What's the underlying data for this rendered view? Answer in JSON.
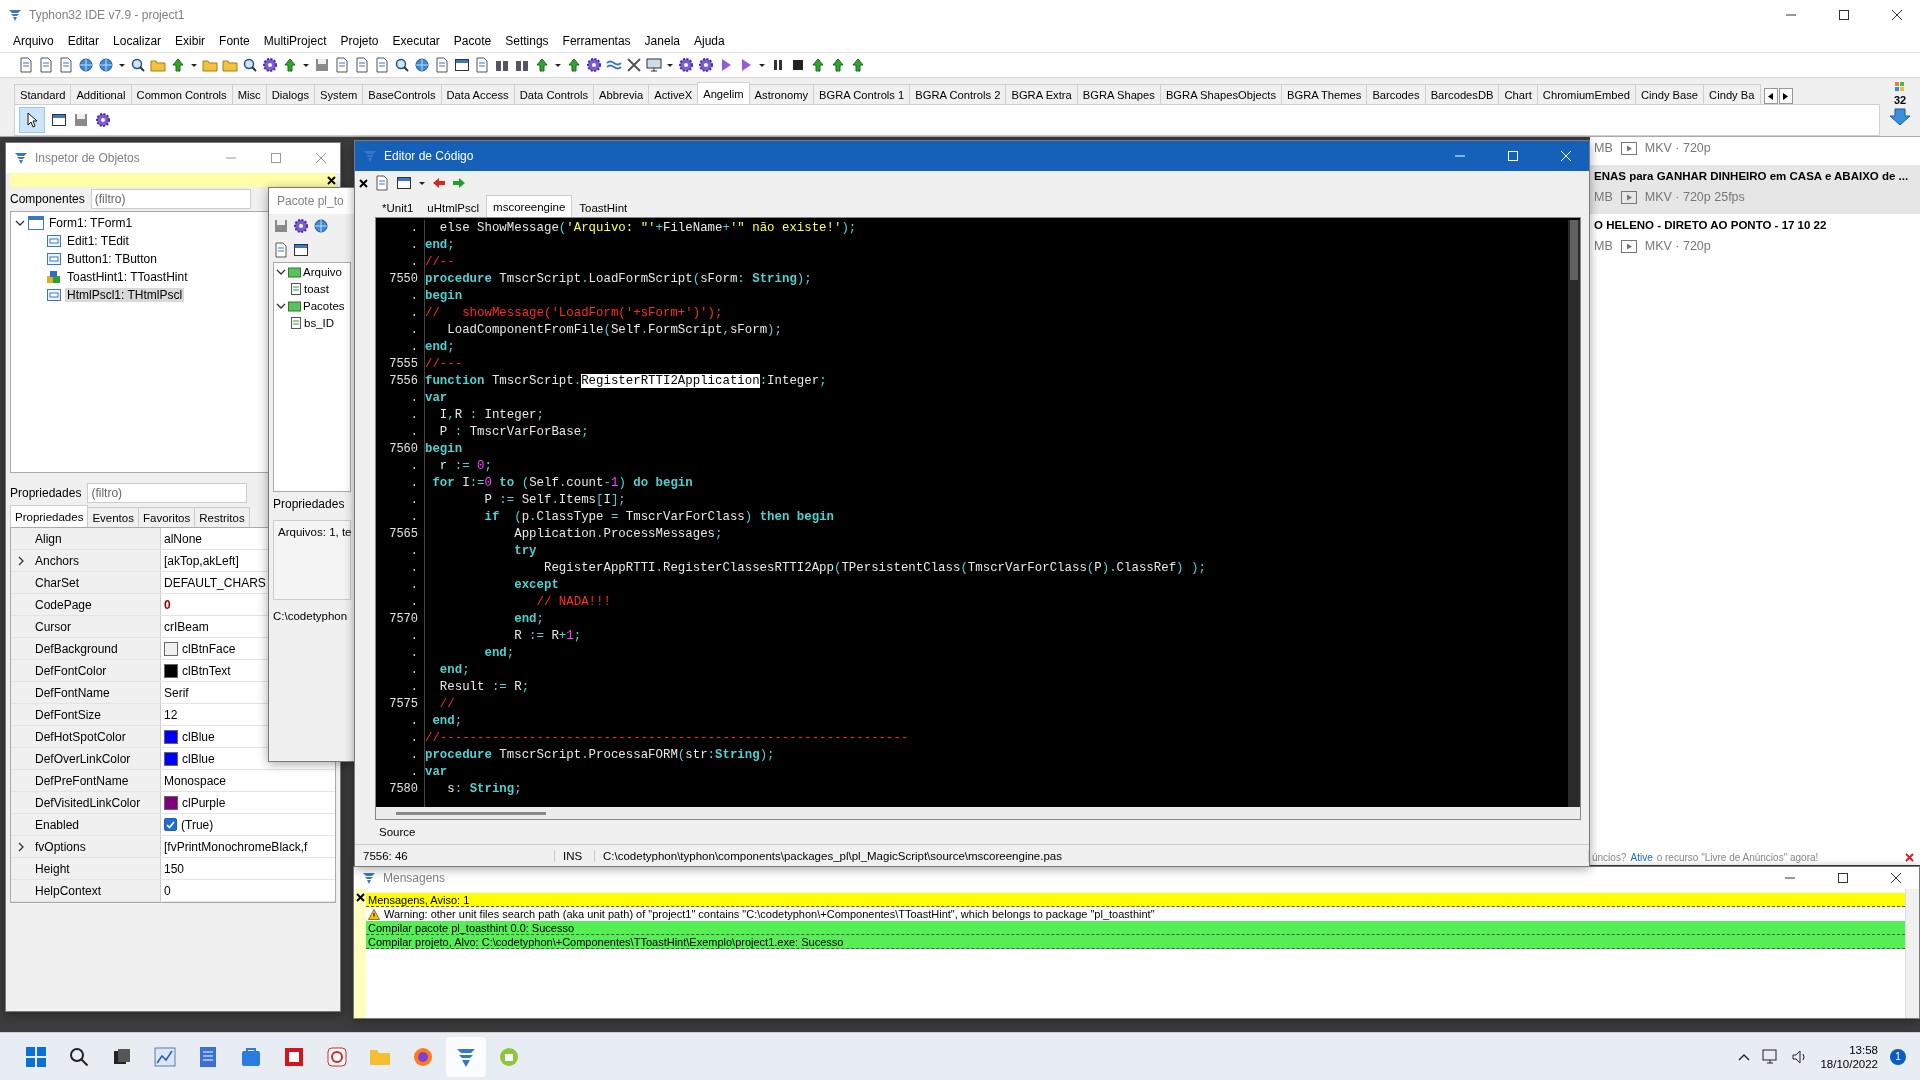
{
  "ide": {
    "title": "Typhon32 IDE v7.9 - project1",
    "menu": [
      "Arquivo",
      "Editar",
      "Localizar",
      "Exibir",
      "Fonte",
      "MultiProject",
      "Projeto",
      "Executar",
      "Pacote",
      "Settings",
      "Ferramentas",
      "Janela",
      "Ajuda"
    ],
    "palette_tabs": [
      {
        "label": "Standard",
        "selected": false
      },
      {
        "label": "Additional",
        "selected": false
      },
      {
        "label": "Common Controls",
        "selected": false
      },
      {
        "label": "Misc",
        "selected": false
      },
      {
        "label": "Dialogs",
        "selected": false
      },
      {
        "label": "System",
        "selected": false
      },
      {
        "label": "BaseControls",
        "selected": false
      },
      {
        "label": "Data Access",
        "selected": false
      },
      {
        "label": "Data Controls",
        "selected": false
      },
      {
        "label": "Abbrevia",
        "selected": false
      },
      {
        "label": "ActiveX",
        "selected": false
      },
      {
        "label": "Angelim",
        "selected": true
      },
      {
        "label": "Astronomy",
        "selected": false
      },
      {
        "label": "BGRA Controls 1",
        "selected": false
      },
      {
        "label": "BGRA Controls 2",
        "selected": false
      },
      {
        "label": "BGRA Extra",
        "selected": false
      },
      {
        "label": "BGRA Shapes",
        "selected": false
      },
      {
        "label": "BGRA ShapesObjects",
        "selected": false
      },
      {
        "label": "BGRA Themes",
        "selected": false
      },
      {
        "label": "Barcodes",
        "selected": false
      },
      {
        "label": "BarcodesDB",
        "selected": false
      },
      {
        "label": "Chart",
        "selected": false
      },
      {
        "label": "ChromiumEmbed",
        "selected": false
      },
      {
        "label": "Cindy Base",
        "selected": false
      },
      {
        "label": "Cindy Ba",
        "selected": false
      }
    ],
    "palette_count": "32"
  },
  "browser_background": {
    "items": [
      {
        "size": "MB",
        "format": "MKV · 720p",
        "highlighted": false
      },
      {
        "title": "ENAS para GANHAR DINHEIRO em CASA e ABAIXO de ...",
        "size": "MB",
        "format": "MKV · 720p 25fps",
        "highlighted": true
      },
      {
        "title": "O HELENO - DIRETO AO PONTO - 17 10 22",
        "size": "MB",
        "format": "MKV · 720p",
        "highlighted": false
      }
    ],
    "ad_text": "úncios?",
    "ad_link": "Ative",
    "ad_text_2": "o recurso \"Livre de Anúncios\" agora!"
  },
  "object_inspector": {
    "title": "Inspetor de Objetos",
    "components_label": "Componentes",
    "components_filter": {
      "placeholder": "(filtro)"
    },
    "tree": [
      {
        "label": "Form1: TForm1",
        "kind": "form",
        "expanded": true,
        "selected": false,
        "children": [
          {
            "label": "Edit1: TEdit",
            "kind": "control",
            "selected": false
          },
          {
            "label": "Button1: TButton",
            "kind": "control",
            "selected": false
          },
          {
            "label": "ToastHint1: TToastHint",
            "kind": "component",
            "selected": false
          },
          {
            "label": "HtmlPscl1: THtmlPscl",
            "kind": "control",
            "selected": true
          }
        ]
      }
    ],
    "properties_label": "Propriedades",
    "properties_filter": {
      "placeholder": "(filtro)"
    },
    "tabs": [
      {
        "label": "Propriedades",
        "selected": true
      },
      {
        "label": "Eventos",
        "selected": false
      },
      {
        "label": "Favoritos",
        "selected": false
      },
      {
        "label": "Restritos",
        "selected": false
      }
    ],
    "properties": [
      {
        "name": "Align",
        "value": "alNone",
        "kind": "text",
        "expandable": false,
        "changed": false
      },
      {
        "name": "Anchors",
        "value": "[akTop,akLeft]",
        "kind": "text",
        "expandable": true,
        "changed": false
      },
      {
        "name": "CharSet",
        "value": "DEFAULT_CHARS",
        "kind": "text",
        "expandable": false,
        "changed": false
      },
      {
        "name": "CodePage",
        "value": "0",
        "kind": "text",
        "expandable": false,
        "changed": true
      },
      {
        "name": "Cursor",
        "value": "crIBeam",
        "kind": "text",
        "expandable": false,
        "changed": false
      },
      {
        "name": "DefBackground",
        "value": "clBtnFace",
        "kind": "color",
        "color": "#f0f0f0",
        "expandable": false,
        "changed": false
      },
      {
        "name": "DefFontColor",
        "value": "clBtnText",
        "kind": "color",
        "color": "#000000",
        "expandable": false,
        "changed": false
      },
      {
        "name": "DefFontName",
        "value": "Serif",
        "kind": "text",
        "expandable": false,
        "changed": false
      },
      {
        "name": "DefFontSize",
        "value": "12",
        "kind": "text",
        "expandable": false,
        "changed": false
      },
      {
        "name": "DefHotSpotColor",
        "value": "clBlue",
        "kind": "color",
        "color": "#0000ff",
        "expandable": false,
        "changed": false
      },
      {
        "name": "DefOverLinkColor",
        "value": "clBlue",
        "kind": "color",
        "color": "#0000ff",
        "expandable": false,
        "changed": false
      },
      {
        "name": "DefPreFontName",
        "value": "Monospace",
        "kind": "text",
        "expandable": false,
        "changed": false
      },
      {
        "name": "DefVisitedLinkColor",
        "value": "clPurple",
        "kind": "color",
        "color": "#800080",
        "expandable": false,
        "changed": false
      },
      {
        "name": "Enabled",
        "value": "(True)",
        "kind": "check",
        "checked": true,
        "expandable": false,
        "changed": false
      },
      {
        "name": "fvOptions",
        "value": "[fvPrintMonochromeBlack,f",
        "kind": "text",
        "expandable": true,
        "changed": false
      },
      {
        "name": "Height",
        "value": "150",
        "kind": "text",
        "expandable": false,
        "changed": false
      },
      {
        "name": "HelpContext",
        "value": "0",
        "kind": "text",
        "expandable": false,
        "changed": false
      }
    ]
  },
  "package_window": {
    "title": "Pacote pl_to",
    "tree": [
      {
        "label": "Arquivo",
        "expanded": true,
        "children": [
          {
            "label": "toast"
          }
        ]
      },
      {
        "label": "Pacotes",
        "expanded": true,
        "children": [
          {
            "label": "bs_ID"
          }
        ]
      }
    ],
    "properties_label": "Propriedades",
    "info": "Arquivos: 1, te",
    "path": "C:\\codetyphon"
  },
  "code_editor": {
    "title": "Editor de Código",
    "tabs": [
      {
        "label": "*Unit1",
        "selected": false
      },
      {
        "label": "uHtmlPscl",
        "selected": false
      },
      {
        "label": "mscoreengine",
        "selected": true
      },
      {
        "label": "ToastHint",
        "selected": false
      }
    ],
    "lines": [
      {
        "number": ".",
        "tokens": [
          {
            "kind": "id",
            "text": "  else ShowMessage"
          },
          {
            "kind": "sym",
            "text": "("
          },
          {
            "kind": "str",
            "text": "'Arquivo: \"'"
          },
          {
            "kind": "sym",
            "text": "+"
          },
          {
            "kind": "id",
            "text": "FileName"
          },
          {
            "kind": "sym",
            "text": "+"
          },
          {
            "kind": "str",
            "text": "'\" não existe!'"
          },
          {
            "kind": "sym",
            "text": ");"
          }
        ]
      },
      {
        "number": ".",
        "tokens": [
          {
            "kind": "kw",
            "text": "end"
          },
          {
            "kind": "sym",
            "text": ";"
          }
        ]
      },
      {
        "number": ".",
        "tokens": [
          {
            "kind": "cmt",
            "text": "//--"
          }
        ]
      },
      {
        "number": "7550",
        "tokens": [
          {
            "kind": "kw",
            "text": "procedure"
          },
          {
            "kind": "id",
            "text": " TmscrScript"
          },
          {
            "kind": "sym",
            "text": "."
          },
          {
            "kind": "id",
            "text": "LoadFormScript"
          },
          {
            "kind": "sym",
            "text": "("
          },
          {
            "kind": "id",
            "text": "sForm"
          },
          {
            "kind": "sym",
            "text": ": "
          },
          {
            "kind": "kw",
            "text": "String"
          },
          {
            "kind": "sym",
            "text": ");"
          }
        ]
      },
      {
        "number": ".",
        "tokens": [
          {
            "kind": "kw",
            "text": "begin"
          }
        ]
      },
      {
        "number": ".",
        "tokens": [
          {
            "kind": "cmt",
            "text": "//   showMessage('LoadForm('+sForm+')');"
          }
        ]
      },
      {
        "number": ".",
        "tokens": [
          {
            "kind": "id",
            "text": "   LoadComponentFromFile"
          },
          {
            "kind": "sym",
            "text": "("
          },
          {
            "kind": "id",
            "text": "Self"
          },
          {
            "kind": "sym",
            "text": "."
          },
          {
            "kind": "id",
            "text": "FormScript"
          },
          {
            "kind": "sym",
            "text": ","
          },
          {
            "kind": "id",
            "text": "sForm"
          },
          {
            "kind": "sym",
            "text": ");"
          }
        ]
      },
      {
        "number": ".",
        "tokens": [
          {
            "kind": "kw",
            "text": "end"
          },
          {
            "kind": "sym",
            "text": ";"
          }
        ]
      },
      {
        "number": "7555",
        "tokens": [
          {
            "kind": "cmt",
            "text": "//---"
          }
        ]
      },
      {
        "number": "7556",
        "tokens": [
          {
            "kind": "kw",
            "text": "function"
          },
          {
            "kind": "id",
            "text": " TmscrScript"
          },
          {
            "kind": "sym",
            "text": "."
          },
          {
            "kind": "sel",
            "text": "RegisterRTTI2Application"
          },
          {
            "kind": "sym",
            "text": ":"
          },
          {
            "kind": "id",
            "text": "Integer"
          },
          {
            "kind": "sym",
            "text": ";"
          }
        ]
      },
      {
        "number": ".",
        "tokens": [
          {
            "kind": "kw",
            "text": "var"
          }
        ]
      },
      {
        "number": ".",
        "tokens": [
          {
            "kind": "id",
            "text": "  I"
          },
          {
            "kind": "sym",
            "text": ","
          },
          {
            "kind": "id",
            "text": "R "
          },
          {
            "kind": "sym",
            "text": ": "
          },
          {
            "kind": "id",
            "text": "Integer"
          },
          {
            "kind": "sym",
            "text": ";"
          }
        ]
      },
      {
        "number": ".",
        "tokens": [
          {
            "kind": "id",
            "text": "  P "
          },
          {
            "kind": "sym",
            "text": ": "
          },
          {
            "kind": "id",
            "text": "TmscrVarForBase"
          },
          {
            "kind": "sym",
            "text": ";"
          }
        ]
      },
      {
        "number": "7560",
        "tokens": [
          {
            "kind": "kw",
            "text": "begin"
          }
        ]
      },
      {
        "number": ".",
        "tokens": [
          {
            "kind": "id",
            "text": "  r "
          },
          {
            "kind": "sym",
            "text": ":= "
          },
          {
            "kind": "num",
            "text": "0"
          },
          {
            "kind": "sym",
            "text": ";"
          }
        ]
      },
      {
        "number": ".",
        "tokens": [
          {
            "kind": "kw",
            "text": " for "
          },
          {
            "kind": "id",
            "text": "I"
          },
          {
            "kind": "sym",
            "text": ":="
          },
          {
            "kind": "num",
            "text": "0"
          },
          {
            "kind": "kw",
            "text": " to "
          },
          {
            "kind": "sym",
            "text": "("
          },
          {
            "kind": "id",
            "text": "Self"
          },
          {
            "kind": "sym",
            "text": "."
          },
          {
            "kind": "id",
            "text": "count"
          },
          {
            "kind": "sym",
            "text": "-"
          },
          {
            "kind": "num",
            "text": "1"
          },
          {
            "kind": "sym",
            "text": ") "
          },
          {
            "kind": "kw",
            "text": "do begin"
          }
        ]
      },
      {
        "number": ".",
        "tokens": [
          {
            "kind": "id",
            "text": "        P "
          },
          {
            "kind": "sym",
            "text": ":= "
          },
          {
            "kind": "id",
            "text": "Self"
          },
          {
            "kind": "sym",
            "text": "."
          },
          {
            "kind": "id",
            "text": "Items"
          },
          {
            "kind": "sym",
            "text": "["
          },
          {
            "kind": "id",
            "text": "I"
          },
          {
            "kind": "sym",
            "text": "];"
          }
        ]
      },
      {
        "number": ".",
        "tokens": [
          {
            "kind": "kw",
            "text": "        if "
          },
          {
            "kind": "sym",
            "text": " ("
          },
          {
            "kind": "id",
            "text": "p"
          },
          {
            "kind": "sym",
            "text": "."
          },
          {
            "kind": "id",
            "text": "ClassType "
          },
          {
            "kind": "sym",
            "text": "= "
          },
          {
            "kind": "id",
            "text": "TmscrVarForClass"
          },
          {
            "kind": "sym",
            "text": ") "
          },
          {
            "kind": "kw",
            "text": "then begin"
          }
        ]
      },
      {
        "number": "7565",
        "tokens": [
          {
            "kind": "id",
            "text": "            Application"
          },
          {
            "kind": "sym",
            "text": "."
          },
          {
            "kind": "id",
            "text": "ProcessMessages"
          },
          {
            "kind": "sym",
            "text": ";"
          }
        ]
      },
      {
        "number": ".",
        "tokens": [
          {
            "kind": "kw",
            "text": "            try"
          }
        ]
      },
      {
        "number": ".",
        "tokens": [
          {
            "kind": "id",
            "text": "                RegisterAppRTTI"
          },
          {
            "kind": "sym",
            "text": "."
          },
          {
            "kind": "id",
            "text": "RegisterClassesRTTI2App"
          },
          {
            "kind": "sym",
            "text": "("
          },
          {
            "kind": "id",
            "text": "TPersistentClass"
          },
          {
            "kind": "sym",
            "text": "("
          },
          {
            "kind": "id",
            "text": "TmscrVarForClass"
          },
          {
            "kind": "sym",
            "text": "("
          },
          {
            "kind": "id",
            "text": "P"
          },
          {
            "kind": "sym",
            "text": ")."
          },
          {
            "kind": "id",
            "text": "ClassRef"
          },
          {
            "kind": "sym",
            "text": ") );"
          }
        ]
      },
      {
        "number": ".",
        "tokens": [
          {
            "kind": "kw",
            "text": "            except"
          }
        ]
      },
      {
        "number": ".",
        "tokens": [
          {
            "kind": "cmt",
            "text": "               // NADA!!!"
          }
        ]
      },
      {
        "number": "7570",
        "tokens": [
          {
            "kind": "kw",
            "text": "            end"
          },
          {
            "kind": "sym",
            "text": ";"
          }
        ]
      },
      {
        "number": ".",
        "tokens": [
          {
            "kind": "id",
            "text": "            R "
          },
          {
            "kind": "sym",
            "text": ":= "
          },
          {
            "kind": "id",
            "text": "R"
          },
          {
            "kind": "sym",
            "text": "+"
          },
          {
            "kind": "num",
            "text": "1"
          },
          {
            "kind": "sym",
            "text": ";"
          }
        ]
      },
      {
        "number": ".",
        "tokens": [
          {
            "kind": "kw",
            "text": "        end"
          },
          {
            "kind": "sym",
            "text": ";"
          }
        ]
      },
      {
        "number": ".",
        "tokens": [
          {
            "kind": "kw",
            "text": "  end"
          },
          {
            "kind": "sym",
            "text": ";"
          }
        ]
      },
      {
        "number": ".",
        "tokens": [
          {
            "kind": "id",
            "text": "  Result "
          },
          {
            "kind": "sym",
            "text": ":= "
          },
          {
            "kind": "id",
            "text": "R"
          },
          {
            "kind": "sym",
            "text": ";"
          }
        ]
      },
      {
        "number": "7575",
        "tokens": [
          {
            "kind": "cmt",
            "text": "  //"
          }
        ]
      },
      {
        "number": ".",
        "tokens": [
          {
            "kind": "kw",
            "text": " end"
          },
          {
            "kind": "sym",
            "text": ";"
          }
        ]
      },
      {
        "number": ".",
        "tokens": [
          {
            "kind": "cmt",
            "text": "//---------------------------------------------------------------"
          }
        ]
      },
      {
        "number": ".",
        "tokens": [
          {
            "kind": "kw",
            "text": "procedure"
          },
          {
            "kind": "id",
            "text": " TmscrScript"
          },
          {
            "kind": "sym",
            "text": "."
          },
          {
            "kind": "id",
            "text": "ProcessaFORM"
          },
          {
            "kind": "sym",
            "text": "("
          },
          {
            "kind": "id",
            "text": "str"
          },
          {
            "kind": "sym",
            "text": ":"
          },
          {
            "kind": "kw",
            "text": "String"
          },
          {
            "kind": "sym",
            "text": ");"
          }
        ]
      },
      {
        "number": ".",
        "tokens": [
          {
            "kind": "kw",
            "text": "var"
          }
        ]
      },
      {
        "number": "7580",
        "tokens": [
          {
            "kind": "id",
            "text": "   s"
          },
          {
            "kind": "sym",
            "text": ": "
          },
          {
            "kind": "kw",
            "text": "String"
          },
          {
            "kind": "sym",
            "text": ";"
          }
        ]
      }
    ],
    "bottom_tab": "Source",
    "status": {
      "position": "7556: 46",
      "mode": "INS",
      "path": "C:\\codetyphon\\typhon\\components\\packages_pl\\pl_MagicScript\\source\\mscoreengine.pas"
    }
  },
  "messages": {
    "title": "Mensagens",
    "rows": [
      {
        "kind": "header",
        "text": "Mensagens, Aviso: 1"
      },
      {
        "kind": "warning",
        "text": "Warning: other unit files search path (aka unit path) of \"project1\" contains \"C:\\codetyphon\\+Componentes\\TToastHint\", which belongs to package \"pl_toasthint\""
      },
      {
        "kind": "success",
        "text": "Compilar pacote pl_toasthint 0.0: Sucesso"
      },
      {
        "kind": "success",
        "text": "Compilar projeto, Alvo: C:\\codetyphon\\+Componentes\\TToastHint\\Exemplo\\project1.exe: Sucesso"
      }
    ]
  },
  "taskbar": {
    "time": "13:58",
    "date": "18/10/2022",
    "notifications": "1"
  }
}
